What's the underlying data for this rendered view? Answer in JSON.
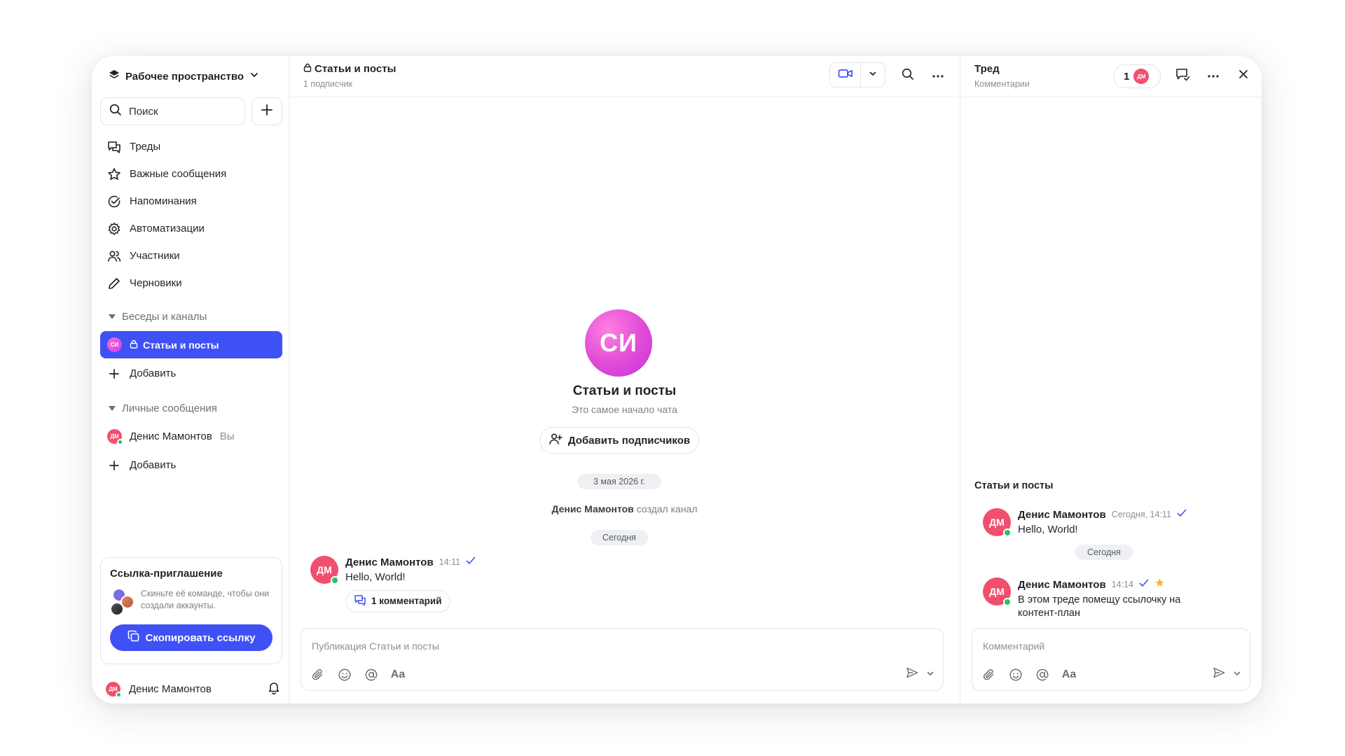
{
  "sidebar": {
    "workspace": "Рабочее пространство",
    "search_placeholder": "Поиск",
    "nav": [
      {
        "label": "Треды",
        "icon": "threads-icon"
      },
      {
        "label": "Важные сообщения",
        "icon": "star-icon"
      },
      {
        "label": "Напоминания",
        "icon": "check-circle-icon"
      },
      {
        "label": "Автоматизации",
        "icon": "gear-icon"
      },
      {
        "label": "Участники",
        "icon": "users-icon"
      },
      {
        "label": "Черновики",
        "icon": "pencil-icon"
      }
    ],
    "channels_section": "Беседы и каналы",
    "channels": [
      {
        "avatar": "СИ",
        "label": "Статьи и посты"
      }
    ],
    "add_channel": "Добавить",
    "dm_section": "Личные сообщения",
    "dms": [
      {
        "avatar": "ДМ",
        "label": "Денис Мамонтов",
        "suffix": "Вы"
      }
    ],
    "add_dm": "Добавить",
    "invite": {
      "title": "Ссылка-приглашение",
      "text": "Скиньте её команде, чтобы они создали аккаунты.",
      "button": "Скопировать ссылку"
    },
    "user": {
      "avatar": "ДМ",
      "name": "Денис Мамонтов"
    }
  },
  "chat": {
    "title": "Статьи и посты",
    "subtitle": "1 подписчик",
    "avatar": "СИ",
    "channel_name": "Статьи и посты",
    "channel_desc": "Это самое начало чата",
    "add_subscribers": "Добавить подписчиков",
    "date_pill": "3 мая 2026 г.",
    "system_author": "Денис Мамонтов",
    "system_text": "создал канал",
    "today_pill": "Сегодня",
    "message": {
      "avatar": "ДМ",
      "author": "Денис Мамонтов",
      "time": "14:11",
      "text": "Hello, World!",
      "replies": "1 комментарий"
    },
    "composer_placeholder": "Публикация Статьи и посты",
    "format_label": "Aa"
  },
  "thread": {
    "title": "Тред",
    "subtitle": "Комментарии",
    "count": "1",
    "count_avatar": "ДМ",
    "section": "Статьи и посты",
    "root": {
      "avatar": "ДМ",
      "author": "Денис Мамонтов",
      "time": "Сегодня, 14:11",
      "text": "Hello, World!"
    },
    "today_pill": "Сегодня",
    "reply": {
      "avatar": "ДМ",
      "author": "Денис Мамонтов",
      "time": "14:14",
      "text": "В этом треде помещу ссылочку на контент-план"
    },
    "composer_placeholder": "Комментарий",
    "format_label": "Aa"
  },
  "colors": {
    "accent": "#3f51f5",
    "avatar_red": "#f24f6e",
    "online": "#22c55e",
    "star": "#f5b829",
    "check": "#3f51f5"
  }
}
